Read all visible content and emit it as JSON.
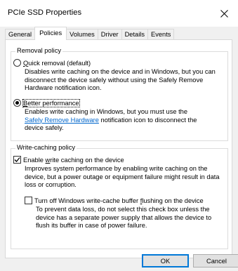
{
  "window": {
    "title": "PCIe SSD Properties"
  },
  "tabs": [
    {
      "label": "General",
      "active": false
    },
    {
      "label": "Policies",
      "active": true
    },
    {
      "label": "Volumes",
      "active": false
    },
    {
      "label": "Driver",
      "active": false
    },
    {
      "label": "Details",
      "active": false
    },
    {
      "label": "Events",
      "active": false
    }
  ],
  "removal_policy": {
    "legend": "Removal policy",
    "quick": {
      "label_pre": "",
      "label_accel": "Q",
      "label_post": "uick removal (default)",
      "checked": false,
      "desc_1": "Disables write caching on the device and in Windows, but you can",
      "desc_2": "disconnect the device safely without using the Safely Remove",
      "desc_3": "Hardware notification icon."
    },
    "better": {
      "label_pre": "",
      "label_accel": "B",
      "label_post": "etter performance",
      "checked": true,
      "desc_1": "Enables write caching in Windows, but you must use the",
      "desc_link": "Safely Remove Hardware",
      "desc_2_rest": " notification icon to disconnect the",
      "desc_3": "device safely."
    }
  },
  "write_caching_policy": {
    "legend": "Write-caching policy",
    "enable": {
      "label_pre": "Enable ",
      "label_accel": "w",
      "label_post": "rite caching on the device",
      "checked": true,
      "desc_1": "Improves system performance by enabling write caching on the",
      "desc_2": "device, but a power outage or equipment failure might result in data",
      "desc_3": "loss or corruption."
    },
    "flush": {
      "label_pre": "Turn off Windows write-cache buffer ",
      "label_accel": "f",
      "label_post": "lushing on the device",
      "checked": false,
      "desc_1": "To prevent data loss, do not select this check box unless the",
      "desc_2": "device has a separate power supply that allows the device to",
      "desc_3": "flush its buffer in case of power failure."
    }
  },
  "buttons": {
    "ok": "OK",
    "cancel": "Cancel"
  },
  "icons": {
    "close": "close-icon",
    "check": "check-icon"
  },
  "colors": {
    "link": "#0066cc",
    "accent": "#0078d7"
  }
}
